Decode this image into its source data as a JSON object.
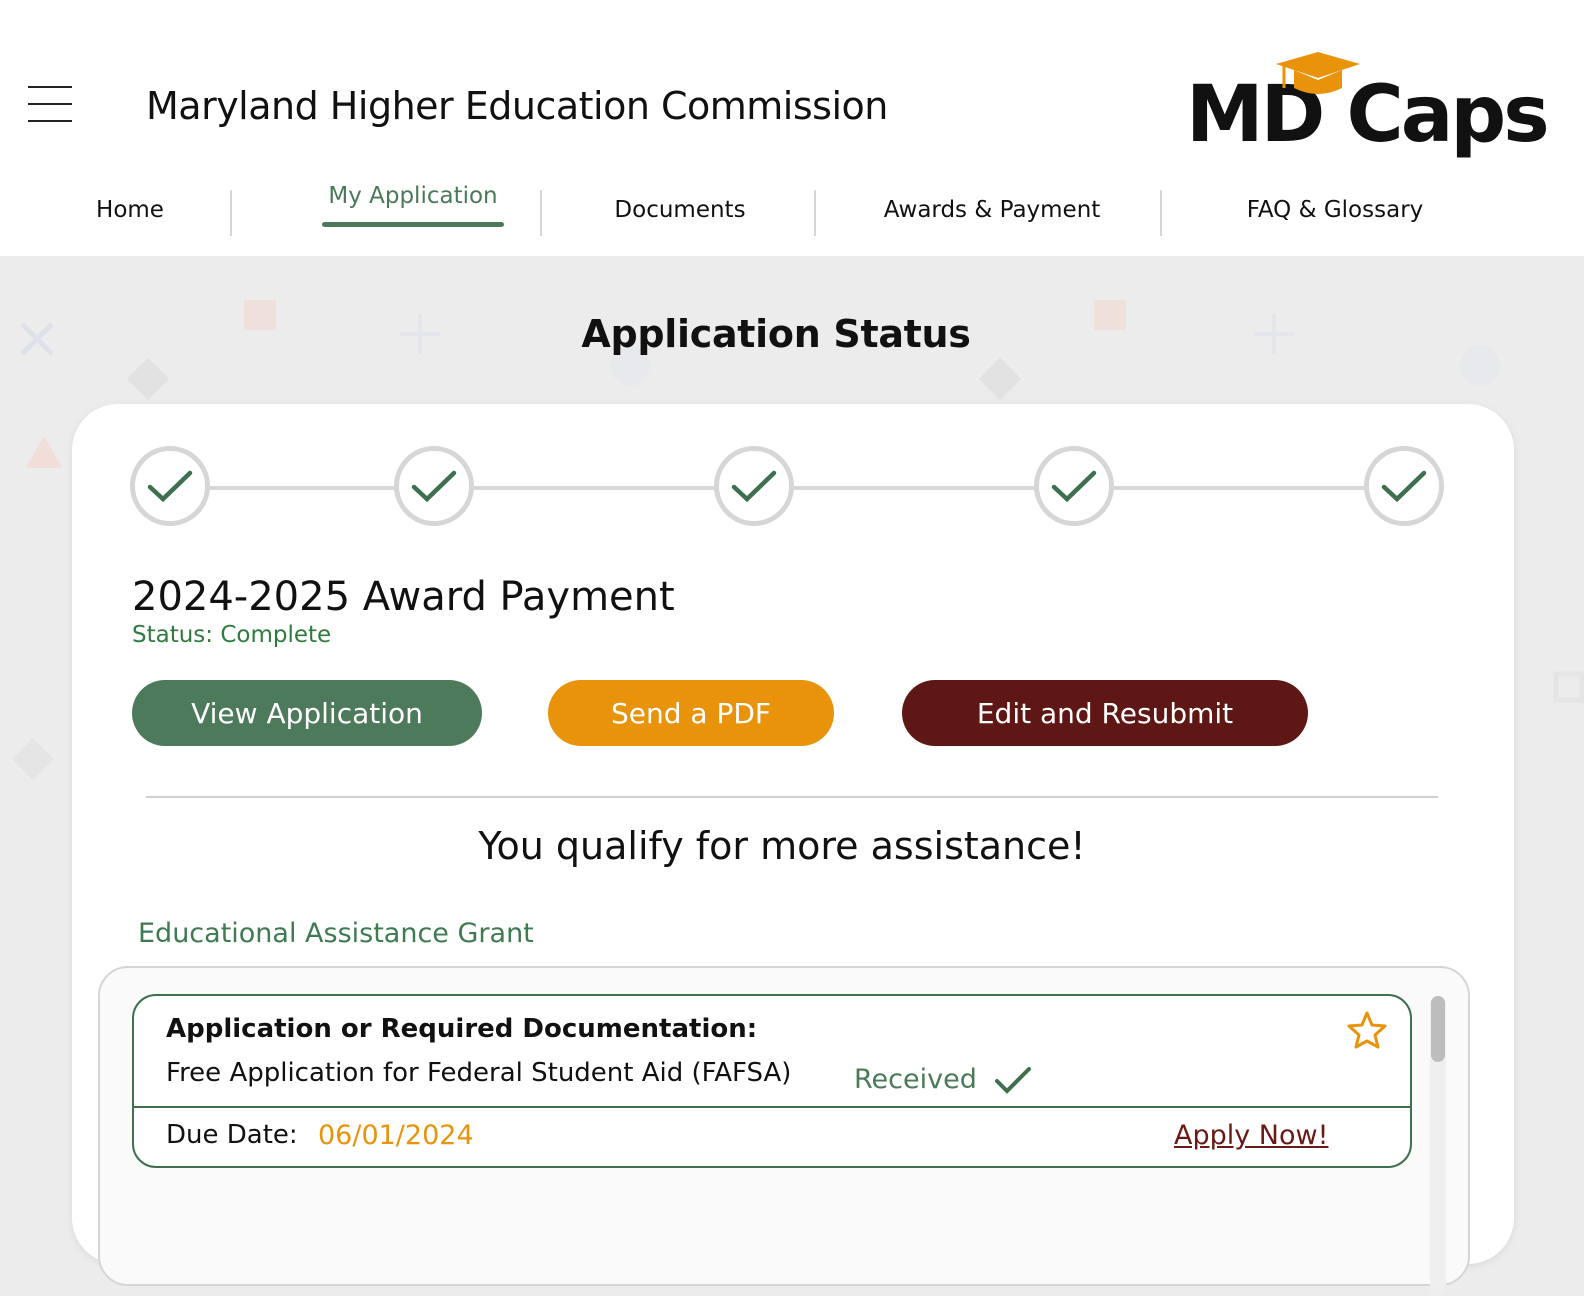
{
  "header": {
    "org_title": "Maryland Higher Education Commission",
    "logo_text": "MD Caps"
  },
  "nav": {
    "items": [
      {
        "label": "Home"
      },
      {
        "label": "My Application"
      },
      {
        "label": "Documents"
      },
      {
        "label": "Awards & Payment"
      },
      {
        "label": "FAQ & Glossary"
      }
    ],
    "active": "My Application"
  },
  "main": {
    "heading": "Application Status",
    "steps_complete": 5,
    "steps_total": 5,
    "award_title": "2024-2025 Award Payment",
    "status": "Status: Complete",
    "buttons": {
      "view": "View Application",
      "pdf": "Send a PDF",
      "edit": "Edit and Resubmit"
    },
    "qualify_heading": "You qualify for more assistance!",
    "grant": {
      "name": "Educational Assistance Grant",
      "doc_heading": "Application or Required Documentation:",
      "doc_name": "Free Application for Federal Student Aid (FAFSA)",
      "doc_status": "Received",
      "due_label": "Due Date:",
      "due_date": "06/01/2024",
      "apply_label": "Apply Now!"
    }
  },
  "colors": {
    "green": "#4c7a5a",
    "orange": "#e8930a",
    "maroon": "#5e1714"
  }
}
